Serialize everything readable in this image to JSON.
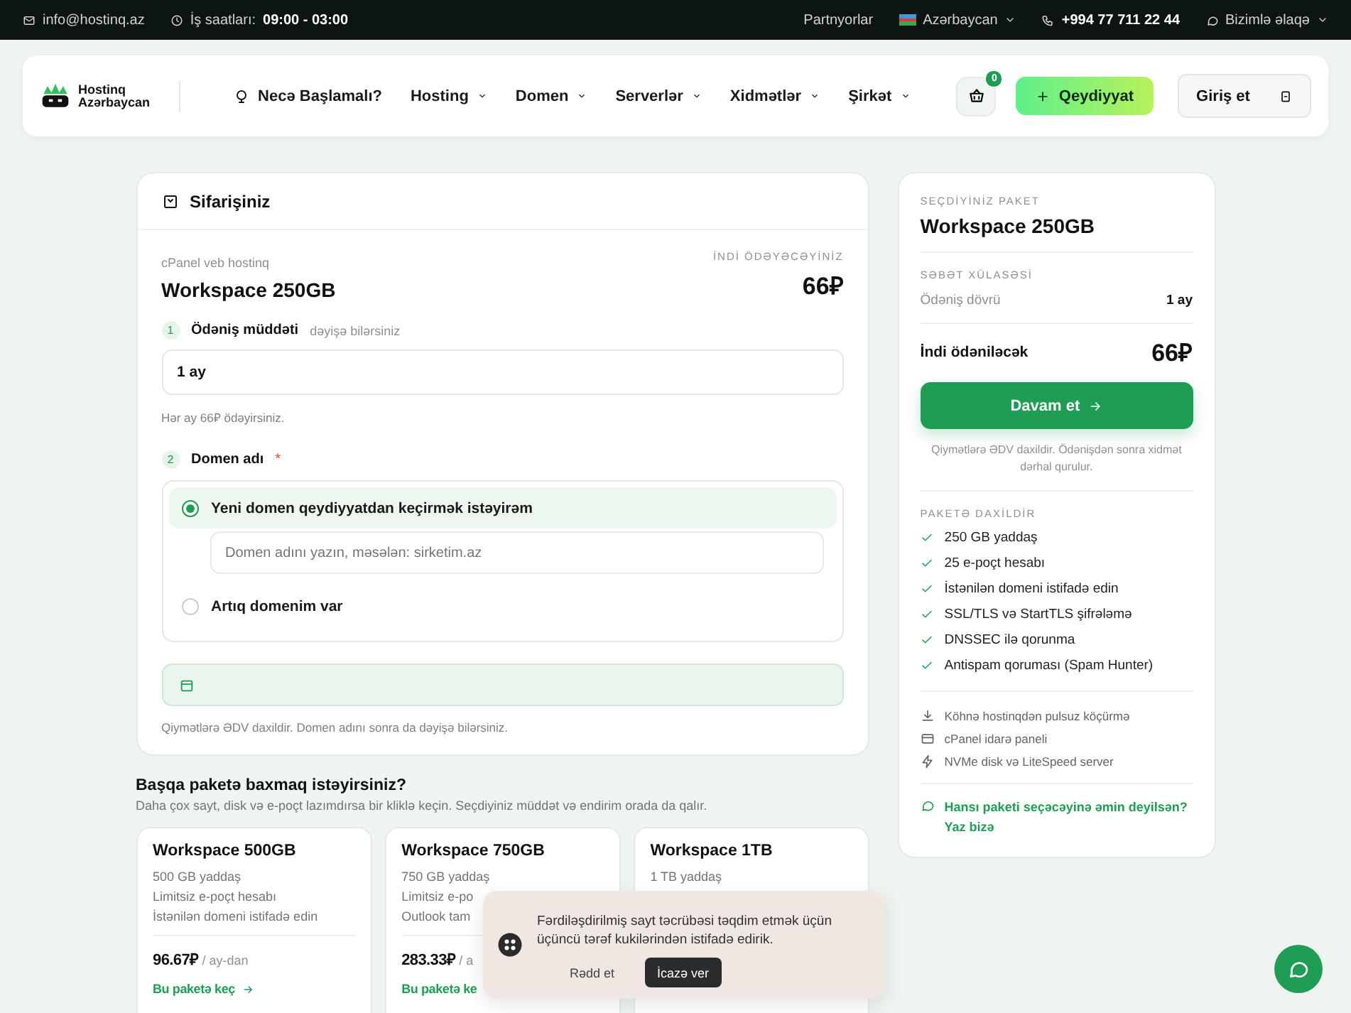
{
  "top_bar": {
    "email": "info@hostinq.az",
    "hours_label": "İş saatları:",
    "hours": "09:00 - 03:00",
    "partners": "Partnyorlar",
    "language": "Azərbaycan",
    "phone": "+994 77 711 22 44",
    "contact": "Bizimlə əlaqə"
  },
  "header": {
    "logo_line1": "Hostinq",
    "logo_line2": "Azərbaycan",
    "nav": [
      {
        "label": "Necə Başlamalı?",
        "dropdown": false
      },
      {
        "label": "Hosting",
        "dropdown": true
      },
      {
        "label": "Domen",
        "dropdown": true
      },
      {
        "label": "Serverlər",
        "dropdown": true
      },
      {
        "label": "Xidmətlər",
        "dropdown": true
      },
      {
        "label": "Şirkət",
        "dropdown": true
      }
    ],
    "cart_count": "0",
    "register": "Qeydiyyat",
    "login": "Giriş et"
  },
  "order": {
    "title": "Sifarişiniz",
    "product_type": "cPanel veb hostinq",
    "product_name": "Workspace 250GB",
    "pay_now_label": "İNDİ ÖDƏYƏCƏYİNİZ",
    "price": "66₽",
    "period_step": {
      "number": "1",
      "label": "Ödəniş müddəti",
      "hint": "dəyişə bilərsiniz",
      "value": "1 ay",
      "note": "Hər ay 66₽ ödəyirsiniz."
    },
    "domain_step": {
      "number": "2",
      "label": "Domen adı",
      "required": "*",
      "options": [
        {
          "label": "Yeni domen qeydiyyatdan keçirmək istəyirəm",
          "selected": true,
          "placeholder": "Domen adını yazın, məsələn: sirketim.az"
        },
        {
          "label": "Artıq domenim var",
          "selected": false
        }
      ]
    },
    "note": "Qiymətlərə ƏDV daxildir. Domen adını sonra da dəyişə bilərsiniz."
  },
  "other_packages": {
    "title": "Başqa paketə baxmaq istəyirsiniz?",
    "subtitle": "Daha çox sayt, disk və e-poçt lazımdırsa bir kliklə keçin. Seçdiyiniz müddət və endirim orada da qalır.",
    "cards": [
      {
        "name": "Workspace 500GB",
        "features": [
          "500 GB yaddaş",
          "Limitsiz e-poçt hesabı",
          "İstənilən domeni istifadə edin"
        ],
        "price": "96.67₽",
        "per": "/ ay-dan",
        "link": "Bu paketə keç",
        "arrow": true
      },
      {
        "name": "Workspace 750GB",
        "features": [
          "750 GB yaddaş",
          "Limitsiz e-po",
          "Outlook tam"
        ],
        "price": "283.33₽",
        "per": "/ a",
        "link": "Bu paketə ke",
        "arrow": false
      },
      {
        "name": "Workspace 1TB",
        "features": [
          "1 TB yaddaş"
        ]
      }
    ]
  },
  "summary": {
    "selected_label": "SEÇDİYİNİZ PAKET",
    "package": "Workspace 250GB",
    "cart_label": "SƏBƏT XÜLASƏSİ",
    "period_label": "Ödəniş dövrü",
    "period_value": "1 ay",
    "due_label": "İndi ödəniləcək",
    "due_value": "66₽",
    "continue": "Davam et",
    "vat_note": "Qiymətlərə ƏDV daxildir. Ödənişdən sonra xidmət dərhal qurulur.",
    "included_label": "PAKETƏ DAXİLDİR",
    "included": [
      "250 GB yaddaş",
      "25 e-poçt hesabı",
      "İstənilən domeni istifadə edin",
      "SSL/TLS və StartTLS şifrələmə",
      "DNSSEC ilə qorunma",
      "Antispam qoruması (Spam Hunter)"
    ],
    "extras": [
      {
        "kind": "download",
        "label": "Köhnə hostinqdən pulsuz köçürmə"
      },
      {
        "kind": "panel",
        "label": "cPanel idarə paneli"
      },
      {
        "kind": "speed",
        "label": "NVMe disk və LiteSpeed server"
      }
    ],
    "help_link": "Hansı paketi seçəcəyinə əmin deyilsən? Yaz bizə"
  },
  "cookie": {
    "text": "Fərdiləşdirilmiş sayt təcrübəsi təqdim etmək üçün üçüncü tərəf kukilərindən istifadə edirik.",
    "reject": "Rədd et",
    "accept": "İcazə ver"
  }
}
